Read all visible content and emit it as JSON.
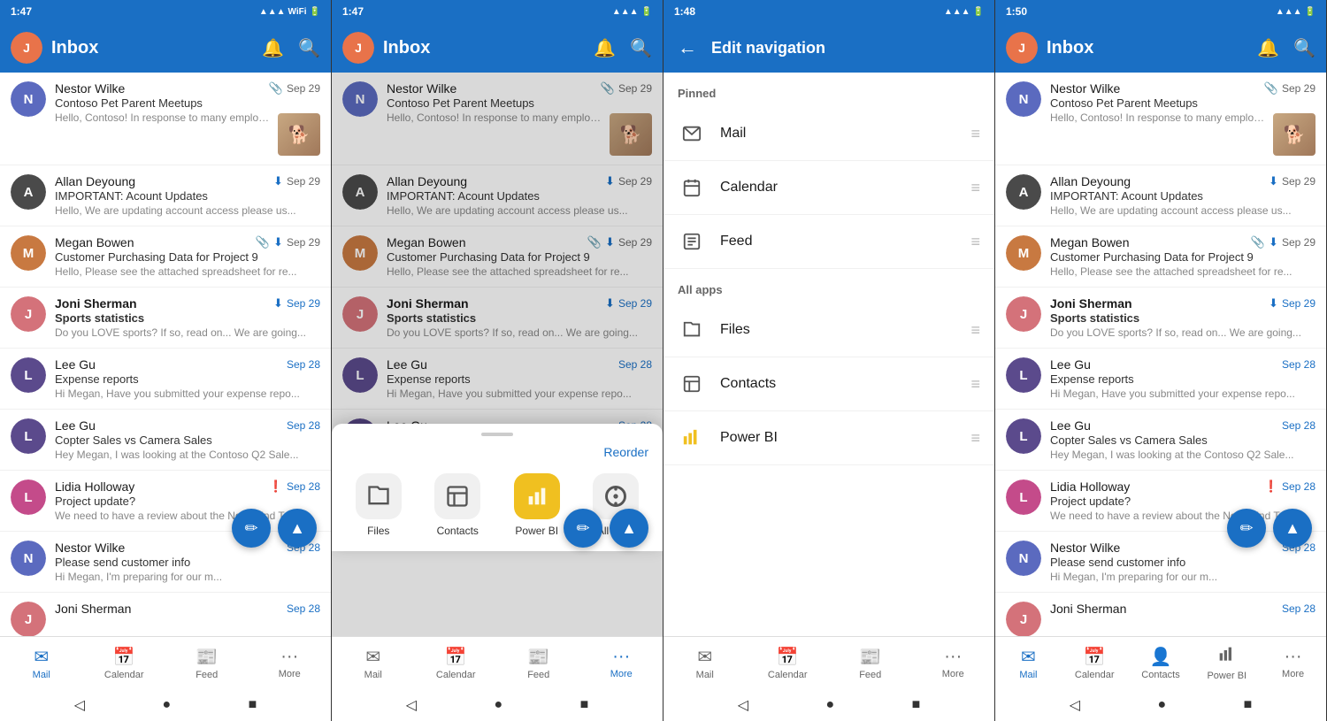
{
  "phones": [
    {
      "id": "phone1",
      "status": {
        "time": "1:47",
        "icons": "📶🔋"
      },
      "header": {
        "title": "Inbox",
        "avatar_color": "#e8734a",
        "avatar_letter": "J"
      },
      "emails": [
        {
          "sender": "Nestor Wilke",
          "date": "Sep 29",
          "date_highlight": false,
          "subject": "Contoso Pet Parent Meetups",
          "preview": "Hello, Contoso! In response to many employee re...",
          "avatar_color": "#5b6abf",
          "avatar_letter": "N",
          "has_attachment": true,
          "has_download": false,
          "has_alert": false,
          "has_thumb": true,
          "unread": false
        },
        {
          "sender": "Allan Deyoung",
          "date": "Sep 29",
          "date_highlight": false,
          "subject": "IMPORTANT: Acount Updates",
          "preview": "Hello, We are updating account access please us...",
          "avatar_color": "#4a4a4a",
          "avatar_letter": "A",
          "has_attachment": false,
          "has_download": true,
          "has_alert": false,
          "has_thumb": false,
          "unread": false
        },
        {
          "sender": "Megan Bowen",
          "date": "Sep 29",
          "date_highlight": false,
          "subject": "Customer Purchasing Data for Project 9",
          "preview": "Hello, Please see the attached spreadsheet for re...",
          "avatar_color": "#c87941",
          "avatar_letter": "M",
          "has_attachment": true,
          "has_download": true,
          "has_alert": false,
          "has_thumb": false,
          "unread": false
        },
        {
          "sender": "Joni Sherman",
          "date": "Sep 29",
          "date_highlight": true,
          "subject": "Sports statistics",
          "preview": "Do you LOVE sports? If so, read on... We are going...",
          "avatar_color": "#d4727a",
          "avatar_letter": "J",
          "has_attachment": false,
          "has_download": true,
          "has_alert": false,
          "has_thumb": false,
          "unread": true
        },
        {
          "sender": "Lee Gu",
          "date": "Sep 28",
          "date_highlight": true,
          "subject": "Expense reports",
          "preview": "Hi Megan, Have you submitted your expense repo...",
          "avatar_color": "#5b4a8c",
          "avatar_letter": "L",
          "has_attachment": false,
          "has_download": false,
          "has_alert": false,
          "has_thumb": false,
          "unread": false
        },
        {
          "sender": "Lee Gu",
          "date": "Sep 28",
          "date_highlight": true,
          "subject": "Copter Sales vs Camera Sales",
          "preview": "Hey Megan, I was looking at the Contoso Q2 Sale...",
          "avatar_color": "#5b4a8c",
          "avatar_letter": "L",
          "has_attachment": false,
          "has_download": false,
          "has_alert": false,
          "has_thumb": false,
          "unread": false
        },
        {
          "sender": "Lidia Holloway",
          "date": "Sep 28",
          "date_highlight": true,
          "subject": "Project update?",
          "preview": "We need to have a review about the Northwind Tr...",
          "avatar_color": "#c44b8a",
          "avatar_letter": "L",
          "has_attachment": false,
          "has_download": false,
          "has_alert": true,
          "has_thumb": false,
          "unread": false
        },
        {
          "sender": "Nestor Wilke",
          "date": "Sep 28",
          "date_highlight": true,
          "subject": "Please send customer info",
          "preview": "Hi Megan, I'm preparing for our m...",
          "avatar_color": "#5b6abf",
          "avatar_letter": "N",
          "has_attachment": false,
          "has_download": false,
          "has_alert": false,
          "has_thumb": false,
          "unread": false
        },
        {
          "sender": "Joni Sherman",
          "date": "Sep 28",
          "date_highlight": true,
          "subject": "",
          "preview": "",
          "avatar_color": "#d4727a",
          "avatar_letter": "J",
          "has_attachment": false,
          "has_download": false,
          "has_alert": false,
          "has_thumb": false,
          "unread": false
        }
      ],
      "bottom_nav": [
        {
          "label": "Mail",
          "icon": "✉",
          "active": true
        },
        {
          "label": "Calendar",
          "icon": "📅",
          "active": false
        },
        {
          "label": "Feed",
          "icon": "📰",
          "active": false
        },
        {
          "label": "More",
          "icon": "•••",
          "active": false
        }
      ]
    },
    {
      "id": "phone2",
      "status": {
        "time": "1:47",
        "icons": "📶🔋"
      },
      "header": {
        "title": "Inbox",
        "avatar_color": "#e8734a",
        "avatar_letter": "J"
      },
      "bottom_sheet": {
        "reorder_label": "Reorder",
        "apps": [
          {
            "label": "Files",
            "icon": "📁",
            "type": "files"
          },
          {
            "label": "Contacts",
            "icon": "👤",
            "type": "contacts"
          },
          {
            "label": "Power BI",
            "icon": "⚡",
            "type": "powerbi"
          },
          {
            "label": "All apps",
            "icon": "+",
            "type": "allapps"
          }
        ]
      },
      "bottom_nav": [
        {
          "label": "Mail",
          "icon": "✉",
          "active": false
        },
        {
          "label": "Calendar",
          "icon": "📅",
          "active": false
        },
        {
          "label": "Feed",
          "icon": "📰",
          "active": false
        },
        {
          "label": "More",
          "icon": "•••",
          "active": true
        }
      ]
    },
    {
      "id": "phone3",
      "status": {
        "time": "1:48",
        "icons": "📶🔋"
      },
      "header": {
        "title": "Edit navigation",
        "show_back": true
      },
      "pinned_label": "Pinned",
      "all_apps_label": "All apps",
      "nav_items_pinned": [
        {
          "label": "Mail",
          "icon": "✉"
        },
        {
          "label": "Calendar",
          "icon": "📅"
        },
        {
          "label": "Feed",
          "icon": "📰"
        }
      ],
      "nav_items_all": [
        {
          "label": "Files",
          "icon": "📁"
        },
        {
          "label": "Contacts",
          "icon": "👤"
        },
        {
          "label": "Power BI",
          "icon": "⚡",
          "color": "powerbi"
        }
      ],
      "bottom_nav": [
        {
          "label": "Mail",
          "icon": "✉",
          "active": false
        },
        {
          "label": "Calendar",
          "icon": "📅",
          "active": false
        },
        {
          "label": "Feed",
          "icon": "📰",
          "active": false
        },
        {
          "label": "More",
          "icon": "•••",
          "active": false
        }
      ]
    },
    {
      "id": "phone4",
      "status": {
        "time": "1:50",
        "icons": "📶🔋"
      },
      "header": {
        "title": "Inbox",
        "avatar_color": "#e8734a",
        "avatar_letter": "J"
      },
      "bottom_nav": [
        {
          "label": "Mail",
          "icon": "✉",
          "active": true
        },
        {
          "label": "Calendar",
          "icon": "📅",
          "active": false
        },
        {
          "label": "Contacts",
          "icon": "👤",
          "active": false
        },
        {
          "label": "Power BI",
          "icon": "⚡",
          "active": false
        },
        {
          "label": "More",
          "icon": "•••",
          "active": false
        }
      ]
    }
  ]
}
